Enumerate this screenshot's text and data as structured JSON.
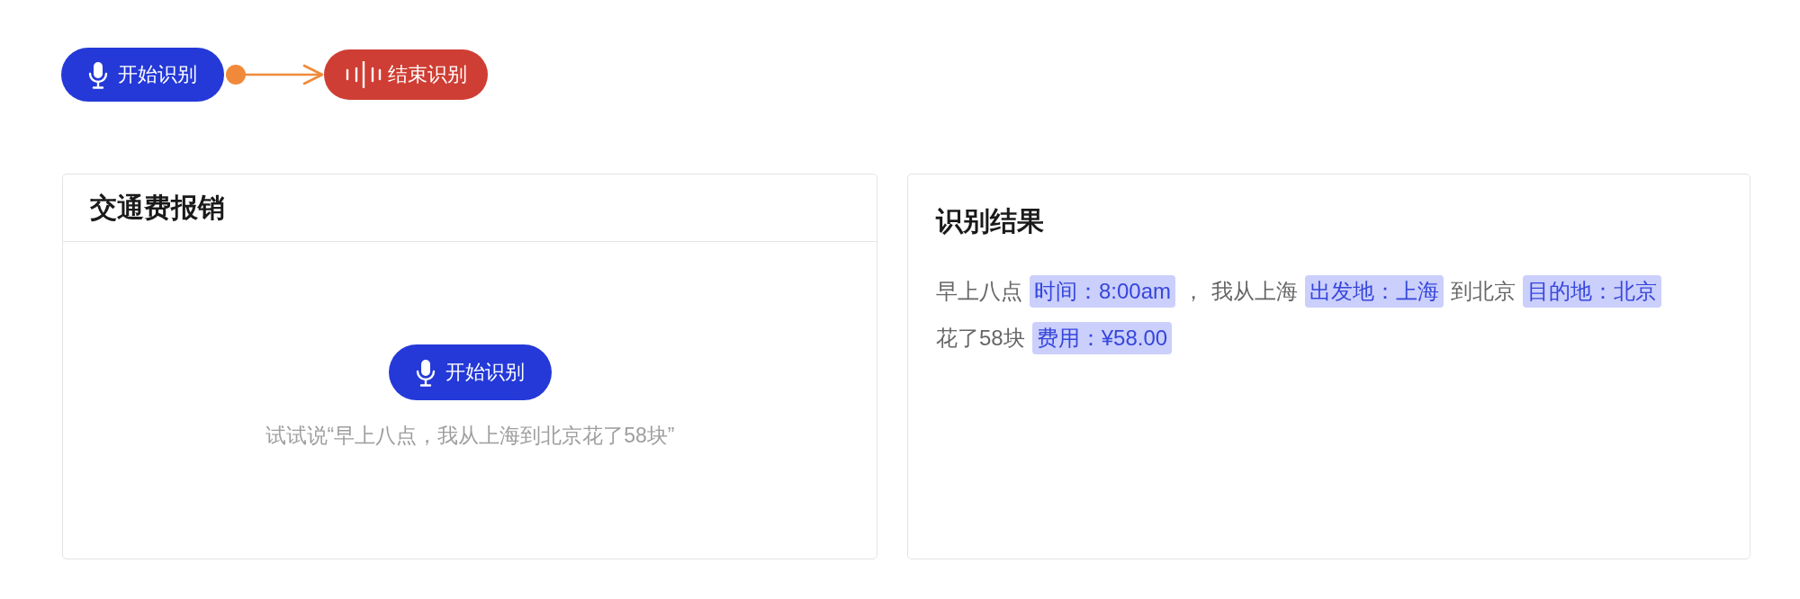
{
  "flow_buttons": [
    {
      "kind": "start",
      "label": "开始识别"
    },
    {
      "kind": "stop",
      "label": "结束识别"
    }
  ],
  "form_card": {
    "title": "交通费报销",
    "button": {
      "kind": "start",
      "label": "开始识别"
    },
    "hint": "试试说“早上八点，我从上海到北京花了58块”"
  },
  "result_card": {
    "title": "识别结果",
    "lines": [
      [
        {
          "kind": "text",
          "text": "早上八点"
        },
        {
          "kind": "tag",
          "text": "时间：8:00am"
        },
        {
          "kind": "text",
          "text": "，"
        },
        {
          "kind": "text",
          "text": "我从上海"
        },
        {
          "kind": "tag",
          "text": "出发地：上海"
        },
        {
          "kind": "text",
          "text": "到北京"
        },
        {
          "kind": "tag",
          "text": "目的地：北京"
        }
      ],
      [
        {
          "kind": "text",
          "text": "花了58块"
        },
        {
          "kind": "tag",
          "text": "费用：¥58.00"
        }
      ]
    ]
  }
}
